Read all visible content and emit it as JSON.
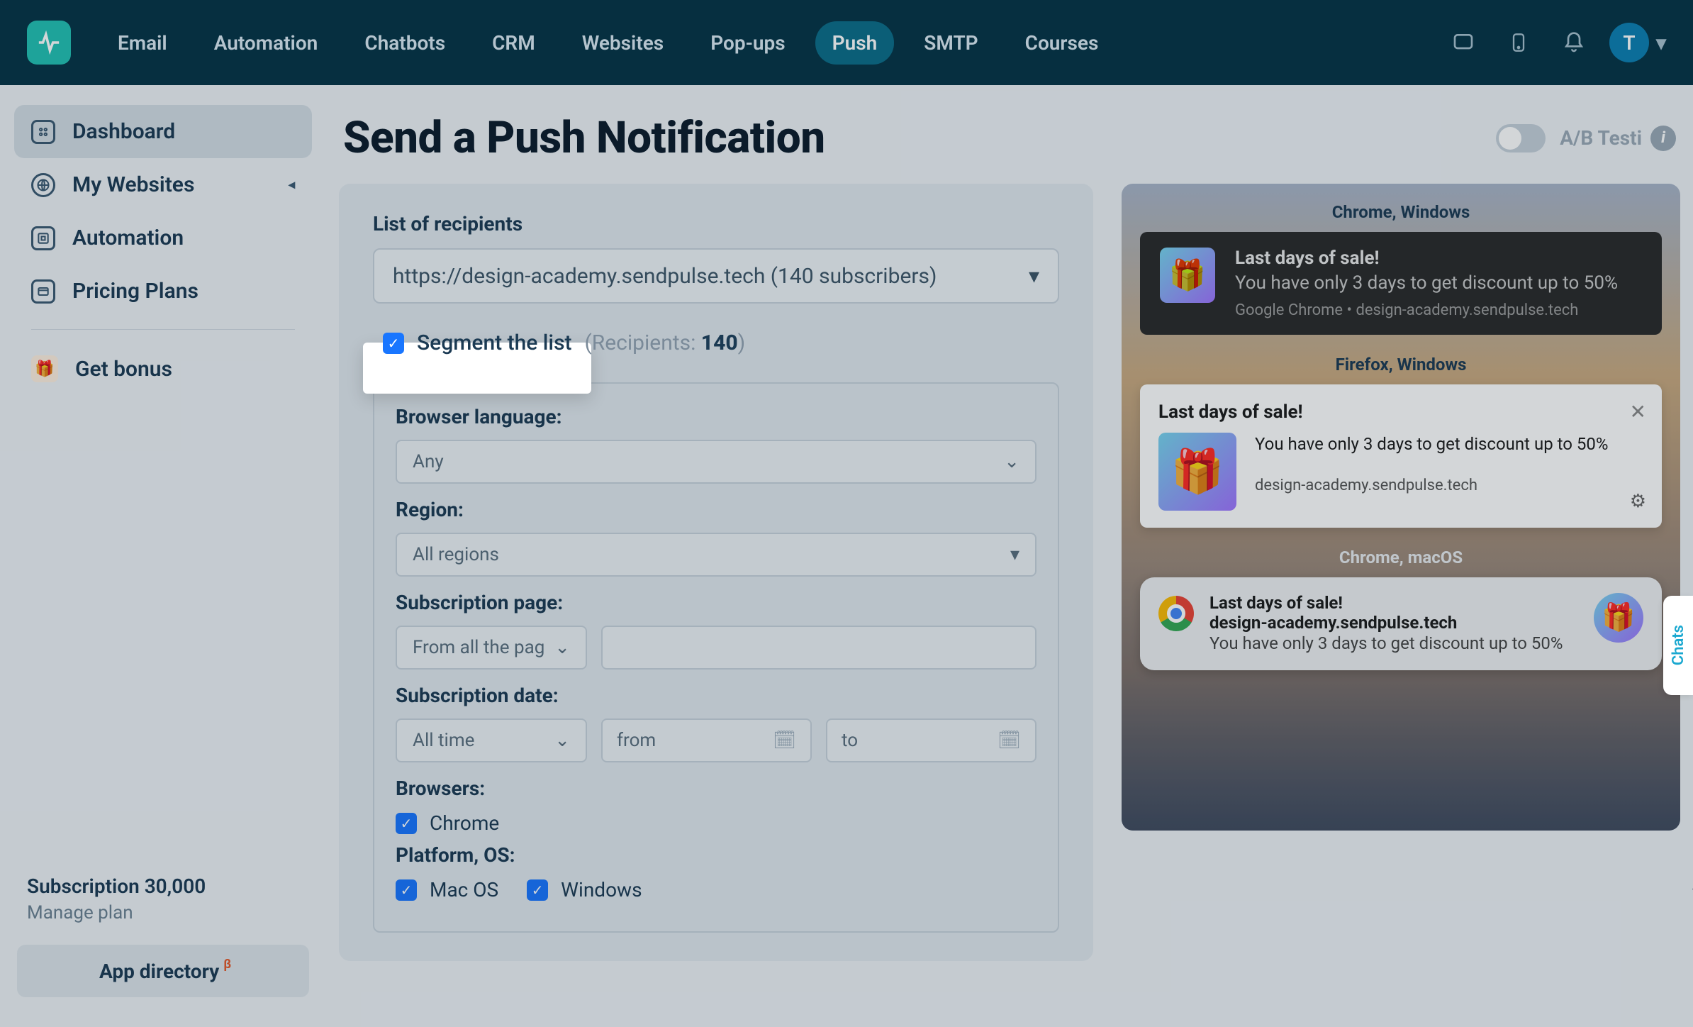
{
  "nav": {
    "items": [
      "Email",
      "Automation",
      "Chatbots",
      "CRM",
      "Websites",
      "Pop-ups",
      "Push",
      "SMTP",
      "Courses"
    ],
    "active_index": 6,
    "avatar_initial": "T"
  },
  "sidebar": {
    "items": [
      {
        "label": "Dashboard",
        "icon": "dashboard-icon"
      },
      {
        "label": "My Websites",
        "icon": "globe-icon",
        "caret": true
      },
      {
        "label": "Automation",
        "icon": "automation-icon"
      },
      {
        "label": "Pricing Plans",
        "icon": "pricing-icon"
      }
    ],
    "bonus_label": "Get bonus",
    "subscription_label": "Subscription 30,000",
    "manage_plan_label": "Manage plan",
    "app_directory_label": "App directory",
    "beta": "β"
  },
  "page": {
    "title": "Send a Push Notification",
    "ab_label": "A/B Testi"
  },
  "form": {
    "recipients_label": "List of recipients",
    "recipients_value": "https://design-academy.sendpulse.tech (140 subscribers)",
    "segment_label": "Segment the list",
    "recipients_word": "(Recipients:",
    "recipients_count": "140",
    "recipients_paren": ")",
    "browser_lang_label": "Browser language:",
    "browser_lang_value": "Any",
    "region_label": "Region:",
    "region_value": "All regions",
    "sub_page_label": "Subscription page:",
    "sub_page_value": "From all the pag",
    "sub_date_label": "Subscription date:",
    "sub_date_value": "All time",
    "from_label": "from",
    "to_label": "to",
    "browsers_label": "Browsers:",
    "browser_chrome": "Chrome",
    "platform_label": "Platform, OS:",
    "platform_mac": "Mac OS",
    "platform_win": "Windows"
  },
  "preview": {
    "labels": [
      "Chrome, Windows",
      "Firefox, Windows",
      "Chrome, macOS"
    ],
    "title": "Last days of sale!",
    "body": "You have only 3 days to get discount up to 50%",
    "chrome_source": "Google Chrome",
    "domain": "design-academy.sendpulse.tech"
  },
  "chats_tab": "Chats"
}
